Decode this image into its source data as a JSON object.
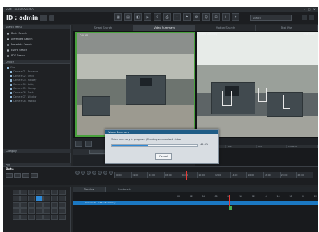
{
  "window": {
    "title": "SSM Console Studio",
    "controls": [
      "–",
      "□",
      "✕"
    ]
  },
  "header": {
    "user_label": "ID : admin",
    "search_placeholder": "Search"
  },
  "sidebar": {
    "search_section": "Search Menu",
    "search_items": [
      "Basic Search",
      "Advanced Search",
      "Metadata Search",
      "Event Search",
      "POS Search"
    ],
    "device_section": "Device",
    "tree_items": [
      "Site",
      "Camera 01 - Entrance",
      "Camera 02 - Office",
      "Camera 03 - Hallway",
      "Camera 04 - Lobby",
      "Camera 05 - Storage",
      "Camera 06 - Desk",
      "Camera 07 - Window",
      "Camera 08 - Parking"
    ],
    "category_section": "Category",
    "pos_section": "POS"
  },
  "tabs": [
    "Smart Search",
    "Video Summary",
    "Motion Search",
    "Text Plus"
  ],
  "cameras": {
    "left_label": "CAM 01",
    "left_time": "",
    "right_label": "Video Summary",
    "right_time": "Time Table"
  },
  "dialog": {
    "title": "Video Summary",
    "message": "Video summary in progress. (Creating summarized video)",
    "progress_pct": 42.6,
    "progress_text": "42.6%",
    "cancel_label": "Cancel"
  },
  "events": {
    "columns": [
      "No",
      "Start",
      "End",
      "Duration"
    ]
  },
  "date": {
    "label": "Date"
  },
  "timeline": {
    "scale": [
      "00:00",
      "02:00",
      "04:00",
      "06:00",
      "08:00",
      "10:00",
      "12:00",
      "14:00",
      "16:00",
      "18:00",
      "20:00",
      "22:00"
    ],
    "tabs": [
      "Timeline",
      "Bookmark"
    ],
    "hours": [
      "00",
      "02",
      "04",
      "06",
      "08",
      "10",
      "12",
      "14",
      "16",
      "18",
      "20",
      "22"
    ],
    "row_label": "Camera 01 - Video Summary"
  },
  "colors": {
    "accent": "#2d88d6",
    "frame": "#232629",
    "highlight": "#49a13d"
  }
}
